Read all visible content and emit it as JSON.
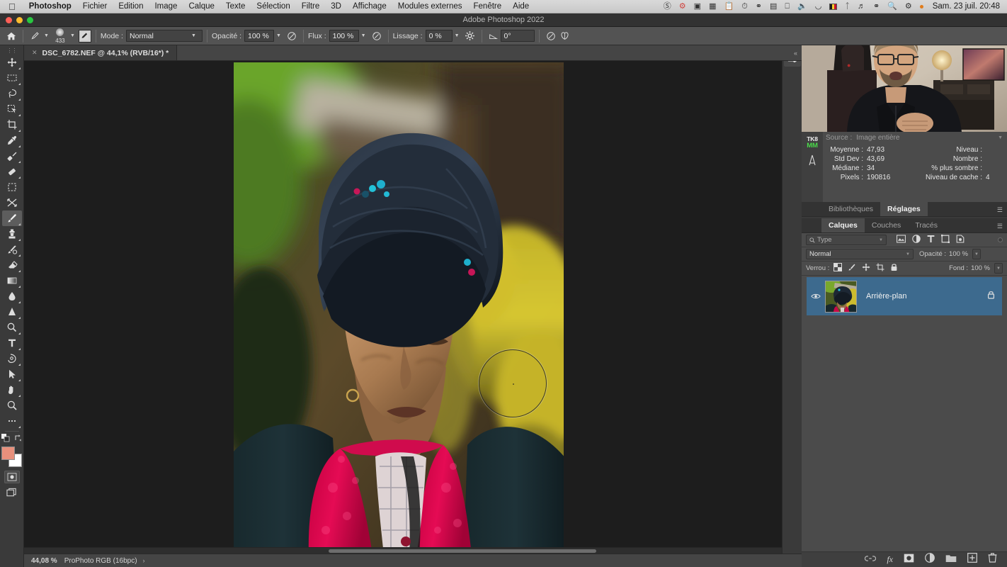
{
  "macbar": {
    "apple_icon": "apple-icon",
    "menus": [
      "Photoshop",
      "Fichier",
      "Edition",
      "Image",
      "Calque",
      "Texte",
      "Sélection",
      "Filtre",
      "3D",
      "Affichage",
      "Modules externes",
      "Fenêtre",
      "Aide"
    ],
    "status_icons": [
      "dropbox-icon",
      "bluejeans-icon",
      "screen-record-icon",
      "display-mirror-icon",
      "clipboard-icon",
      "time-machine-icon",
      "binoculars-icon",
      "bartender-icon",
      "monitor-icon",
      "volume-icon",
      "wifi-icon",
      "belgium-flag-icon",
      "bluetooth-icon",
      "headphones-icon",
      "controlcenter-icon",
      "spotlight-search-icon",
      "siri-icon"
    ],
    "clock": "Sam. 23 juil.  20:48"
  },
  "window": {
    "title": "Adobe Photoshop 2022",
    "traffic_lights": [
      "#ff5f57",
      "#febc2e",
      "#28c840"
    ]
  },
  "options_bar": {
    "home_icon": "home-icon",
    "brush_preset_icon": "brush-preset-icon",
    "brush_size": "433",
    "brush_panel_icon": "brush-panel-icon",
    "mode_label": "Mode :",
    "mode_value": "Normal",
    "opacity_label": "Opacité :",
    "opacity_value": "100 %",
    "opacity_pressure_icon": "pressure-opacity-icon",
    "flow_label": "Flux :",
    "flow_value": "100 %",
    "airbrush_icon": "airbrush-icon",
    "smoothing_label": "Lissage :",
    "smoothing_value": "0 %",
    "smoothing_gear_icon": "gear-icon",
    "angle_icon": "angle-icon",
    "angle_value": "0°",
    "pressure_size_icon": "pressure-size-icon",
    "symmetry_icon": "symmetry-butterfly-icon"
  },
  "document": {
    "tab_close_icon": "close-icon",
    "tab_title": "DSC_6782.NEF @ 44,1% (RVB/16*) *",
    "collapse_icon": "collapse-arrows-icon"
  },
  "toolbar": {
    "grip_icon": "panel-grip-icon",
    "tools": [
      {
        "name": "move-tool",
        "icon": "move-icon",
        "selected": false,
        "hasmenu": true
      },
      {
        "name": "rectangular-marquee-tool",
        "icon": "marquee-icon",
        "selected": false,
        "hasmenu": true
      },
      {
        "name": "lasso-tool",
        "icon": "lasso-icon",
        "selected": false,
        "hasmenu": true
      },
      {
        "name": "object-selection-tool",
        "icon": "quick-selection-icon",
        "selected": false,
        "hasmenu": true
      },
      {
        "name": "crop-tool",
        "icon": "crop-icon",
        "selected": false,
        "hasmenu": true
      },
      {
        "name": "eyedropper-tool",
        "icon": "eyedropper-icon",
        "selected": false,
        "hasmenu": true
      },
      {
        "name": "spot-healing-brush-tool",
        "icon": "healing-brush-icon",
        "selected": false,
        "hasmenu": true
      },
      {
        "name": "patch-tool",
        "icon": "patch-icon",
        "selected": false,
        "hasmenu": true
      },
      {
        "name": "frame-tool",
        "icon": "frame-icon",
        "selected": false,
        "hasmenu": false
      },
      {
        "name": "transform-tool",
        "icon": "transform-icon",
        "selected": false,
        "hasmenu": false
      },
      {
        "name": "brush-tool",
        "icon": "brush-icon",
        "selected": true,
        "hasmenu": true
      },
      {
        "name": "clone-stamp-tool",
        "icon": "stamp-icon",
        "selected": false,
        "hasmenu": true
      },
      {
        "name": "history-brush-tool",
        "icon": "history-brush-icon",
        "selected": false,
        "hasmenu": true
      },
      {
        "name": "eraser-tool",
        "icon": "eraser-icon",
        "selected": false,
        "hasmenu": true
      },
      {
        "name": "gradient-tool",
        "icon": "gradient-icon",
        "selected": false,
        "hasmenu": true
      },
      {
        "name": "blur-tool",
        "icon": "blur-drop-icon",
        "selected": false,
        "hasmenu": true
      },
      {
        "name": "dodge-tool",
        "icon": "dodge-icon",
        "selected": false,
        "hasmenu": true
      },
      {
        "name": "pen-tool-sel",
        "icon": "magnify-pen-icon",
        "selected": false,
        "hasmenu": true
      },
      {
        "name": "type-tool",
        "icon": "type-icon",
        "selected": false,
        "hasmenu": true
      },
      {
        "name": "pen-tool",
        "icon": "pen-icon",
        "selected": false,
        "hasmenu": true
      },
      {
        "name": "path-selection-tool",
        "icon": "path-arrow-icon",
        "selected": false,
        "hasmenu": true
      },
      {
        "name": "hand-tool",
        "icon": "hand-icon",
        "selected": false,
        "hasmenu": true
      },
      {
        "name": "zoom-tool",
        "icon": "zoom-icon",
        "selected": false,
        "hasmenu": false
      },
      {
        "name": "edit-toolbar-button",
        "icon": "ellipsis-icon",
        "selected": false,
        "hasmenu": false
      }
    ],
    "default_colors_icon": "default-colors-icon",
    "swap_colors_icon": "swap-colors-icon",
    "foreground_color": "#e8907c",
    "background_color": "#ffffff",
    "quickmask_icon": "quick-mask-icon",
    "screenmode_icon": "screen-mode-icon"
  },
  "status_bar": {
    "zoom": "44,08 %",
    "color_mode": "ProPhoto RGB (16bpc)",
    "arrow_icon": "chevron-right-icon"
  },
  "panel_strip": {
    "adjustments_icon": "adjustments-sliders-icon"
  },
  "histogram": {
    "plugin_badge_top": "TK8",
    "plugin_badge_bottom": "MM",
    "plugin_tool_icon": "tk-actions-icon",
    "source_label": "Source :",
    "source_value": "Image entière",
    "dropdown_icon": "chevron-down-icon",
    "stats": [
      {
        "label": "Moyenne :",
        "value": "47,93",
        "label2": "Niveau :",
        "value2": ""
      },
      {
        "label": "Std Dev :",
        "value": "43,69",
        "label2": "Nombre :",
        "value2": ""
      },
      {
        "label": "Médiane :",
        "value": "34",
        "label2": "% plus sombre :",
        "value2": ""
      },
      {
        "label": "Pixels :",
        "value": "190816",
        "label2": "Niveau de cache :",
        "value2": "4"
      }
    ]
  },
  "panel_tabs_top": {
    "tabs": [
      {
        "label": "Bibliothèques",
        "active": false
      },
      {
        "label": "Réglages",
        "active": true
      }
    ],
    "menu_icon": "panel-menu-icon"
  },
  "panel_tabs_layers": {
    "tabs": [
      {
        "label": "Calques",
        "active": true
      },
      {
        "label": "Couches",
        "active": false
      },
      {
        "label": "Tracés",
        "active": false
      }
    ],
    "menu_icon": "panel-menu-icon"
  },
  "layers_panel": {
    "search_icon": "search-icon",
    "search_placeholder": "Type",
    "filter_icons": [
      "pixel-filter-icon",
      "adjustment-filter-icon",
      "type-filter-icon",
      "shape-filter-icon",
      "smart-object-filter-icon"
    ],
    "filter_toggle_icon": "filter-toggle-icon",
    "blend_mode": "Normal",
    "opacity_label": "Opacité :",
    "opacity_value": "100 %",
    "lock_label": "Verrou :",
    "lock_icons": [
      "lock-transparency-icon",
      "lock-image-icon",
      "lock-position-icon",
      "lock-artboard-icon",
      "lock-all-icon"
    ],
    "fill_label": "Fond :",
    "fill_value": "100 %",
    "layers": [
      {
        "name": "Arrière-plan",
        "visible": true,
        "locked": true,
        "selected": true,
        "eye_icon": "eye-icon",
        "lock_icon": "lock-icon"
      }
    ],
    "bottom_icons": [
      "link-layers-icon",
      "layer-style-fx-icon",
      "add-mask-icon",
      "adjustment-layer-icon",
      "new-group-icon",
      "new-layer-icon",
      "delete-layer-icon"
    ]
  }
}
